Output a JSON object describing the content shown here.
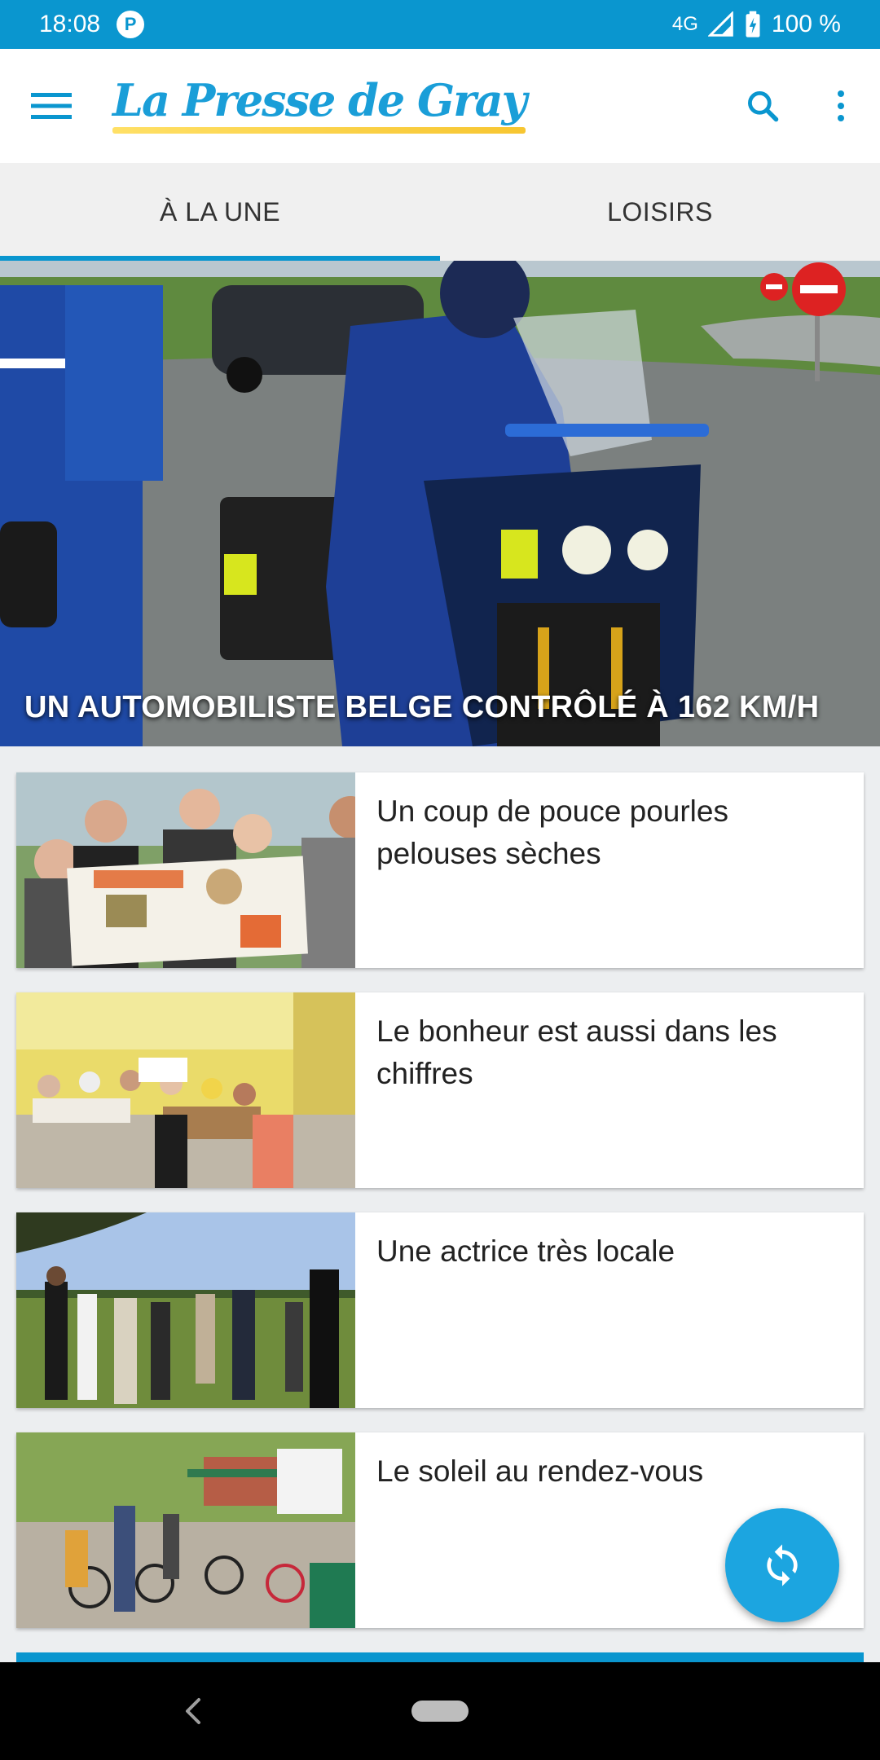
{
  "status_bar": {
    "time": "18:08",
    "network": "4G",
    "battery": "100 %"
  },
  "app_bar": {
    "logo_text": "La Presse de Gray",
    "menu_icon": "hamburger-menu-icon",
    "search_icon": "search-icon",
    "more_icon": "more-vert-icon",
    "colors": {
      "brand": "#0a96cf",
      "logo": "#1a9ed8",
      "underline": "#f7c631"
    }
  },
  "tabs": [
    {
      "label": "À LA UNE",
      "active": true
    },
    {
      "label": "LOISIRS",
      "active": false
    }
  ],
  "hero": {
    "caption": "UN AUTOMOBILISTE BELGE CONTRÔLÉ À 162 KM/H"
  },
  "articles": [
    {
      "title": "Un coup de pouce pourles pelouses sèches"
    },
    {
      "title": "Le bonheur est aussi dans les chiffres"
    },
    {
      "title": "Une actrice très locale"
    },
    {
      "title": "Le soleil au rendez-vous"
    }
  ],
  "fab": {
    "icon": "refresh-icon"
  },
  "nav_bar": {
    "back_icon": "back-chevron-icon",
    "home_icon": "home-pill-icon"
  }
}
